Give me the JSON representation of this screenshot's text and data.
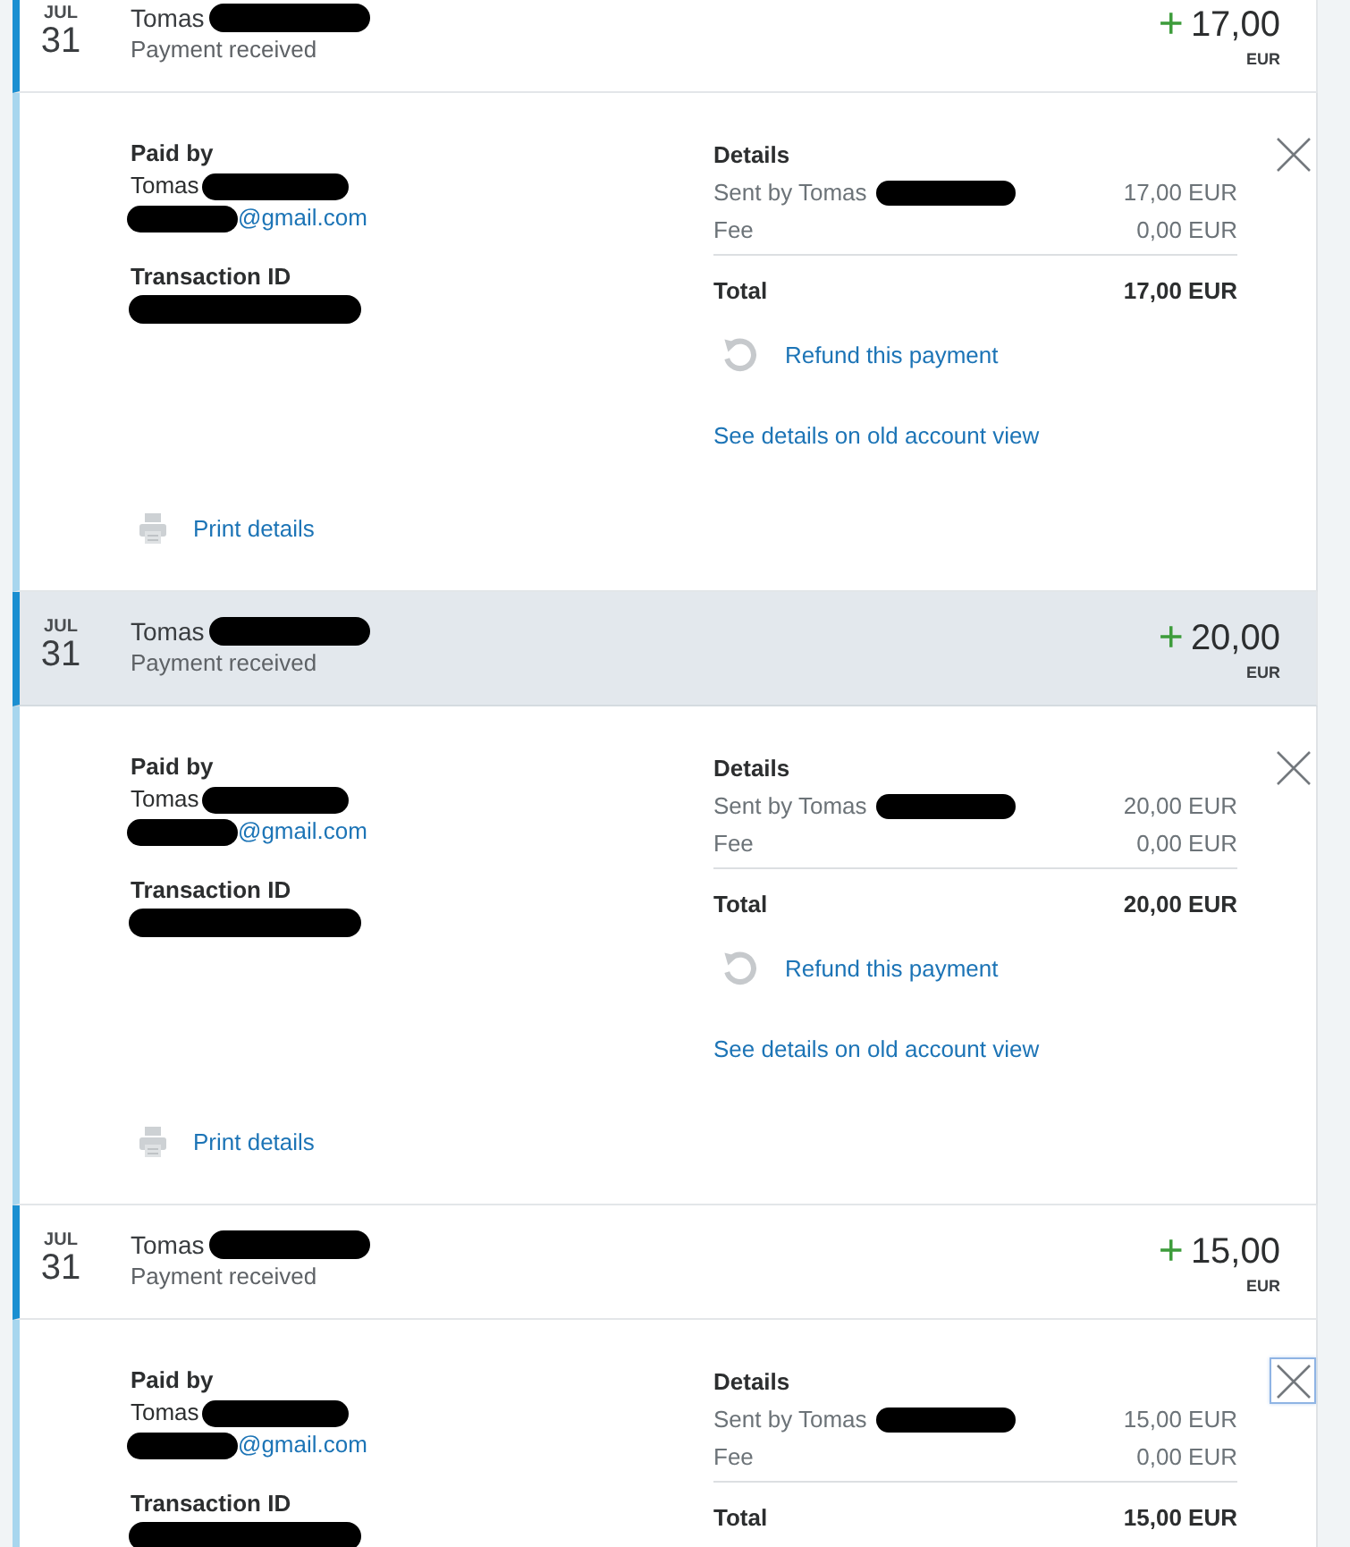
{
  "transactions": [
    {
      "month": "JUL",
      "day": "31",
      "name": "Tomas",
      "type": "Payment received",
      "sign": "+",
      "amount": "17,00",
      "currency": "EUR",
      "hovered": false,
      "redacted": true,
      "expanded": true,
      "detail": {
        "paid_by_label": "Paid by",
        "payer_name": "Tomas",
        "payer_email": "@gmail.com",
        "transaction_id_label": "Transaction ID",
        "details_label": "Details",
        "lines": [
          {
            "label": "Sent by Tomas",
            "redacted": true,
            "value": "17,00 EUR"
          },
          {
            "label": "Fee",
            "redacted": false,
            "value": "0,00 EUR"
          }
        ],
        "total_label": "Total",
        "total_value": "17,00 EUR",
        "refund_link": "Refund this payment",
        "old_view_link": "See details on old account view",
        "print_link": "Print details",
        "close_focused": false
      }
    },
    {
      "month": "JUL",
      "day": "31",
      "name": "Tomas",
      "type": "Payment received",
      "sign": "+",
      "amount": "20,00",
      "currency": "EUR",
      "hovered": true,
      "redacted": true,
      "expanded": true,
      "detail": {
        "paid_by_label": "Paid by",
        "payer_name": "Tomas",
        "payer_email": "@gmail.com",
        "transaction_id_label": "Transaction ID",
        "details_label": "Details",
        "lines": [
          {
            "label": "Sent by Tomas",
            "redacted": true,
            "value": "20,00 EUR"
          },
          {
            "label": "Fee",
            "redacted": false,
            "value": "0,00 EUR"
          }
        ],
        "total_label": "Total",
        "total_value": "20,00 EUR",
        "refund_link": "Refund this payment",
        "old_view_link": "See details on old account view",
        "print_link": "Print details",
        "close_focused": false
      }
    },
    {
      "month": "JUL",
      "day": "31",
      "name": "Tomas",
      "type": "Payment received",
      "sign": "+",
      "amount": "15,00",
      "currency": "EUR",
      "hovered": false,
      "redacted": true,
      "expanded": true,
      "detail": {
        "paid_by_label": "Paid by",
        "payer_name": "Tomas",
        "payer_email": "@gmail.com",
        "transaction_id_label": "Transaction ID",
        "details_label": "Details",
        "lines": [
          {
            "label": "Sent by Tomas",
            "redacted": true,
            "value": "15,00 EUR"
          },
          {
            "label": "Fee",
            "redacted": false,
            "value": "0,00 EUR"
          }
        ],
        "total_label": "Total",
        "total_value": "15,00 EUR",
        "close_focused": true
      }
    }
  ]
}
